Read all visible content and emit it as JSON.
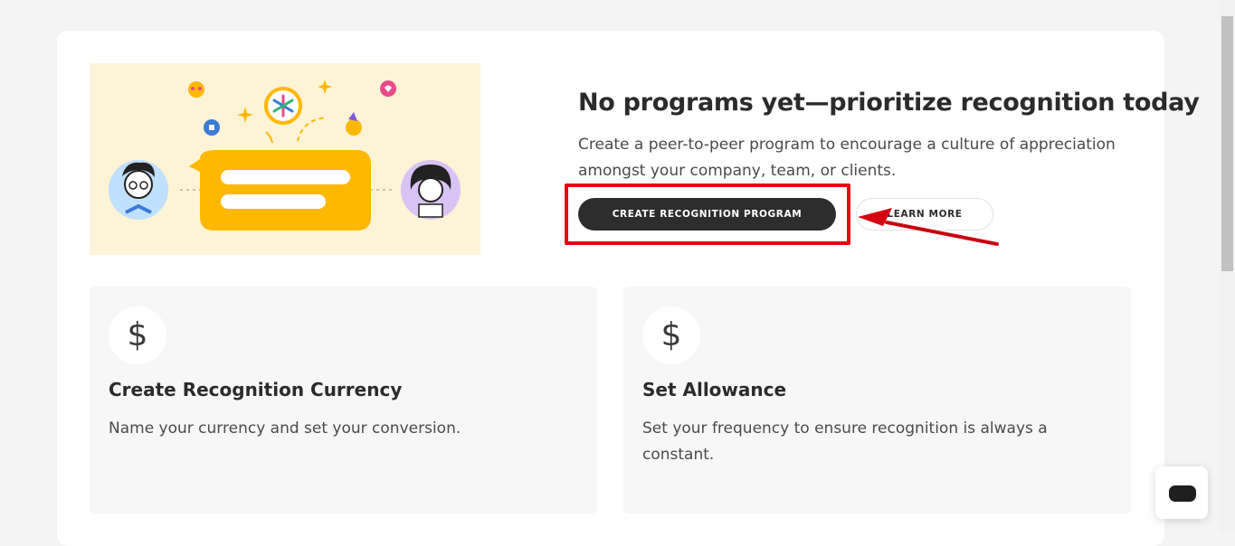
{
  "hero": {
    "headline": "No programs yet—prioritize recognition today",
    "subtitle": "Create a peer-to-peer program to encourage a culture of appreciation amongst your company, team, or clients.",
    "primary_button": "CREATE RECOGNITION PROGRAM",
    "secondary_button": "LEARN MORE"
  },
  "features": [
    {
      "icon": "dollar-icon",
      "icon_glyph": "$",
      "title": "Create Recognition Currency",
      "description": "Name your currency and set your conversion."
    },
    {
      "icon": "dollar-icon",
      "icon_glyph": "$",
      "title": "Set Allowance",
      "description": "Set your frequency to ensure recognition is always a constant."
    }
  ],
  "chat": {
    "icon": "chat-bubble-icon"
  },
  "colors": {
    "accent_dark": "#2d2d2d",
    "highlight": "#e30613",
    "illustration_bg": "#fdf3d6",
    "speech_bubble": "#ffb800"
  }
}
